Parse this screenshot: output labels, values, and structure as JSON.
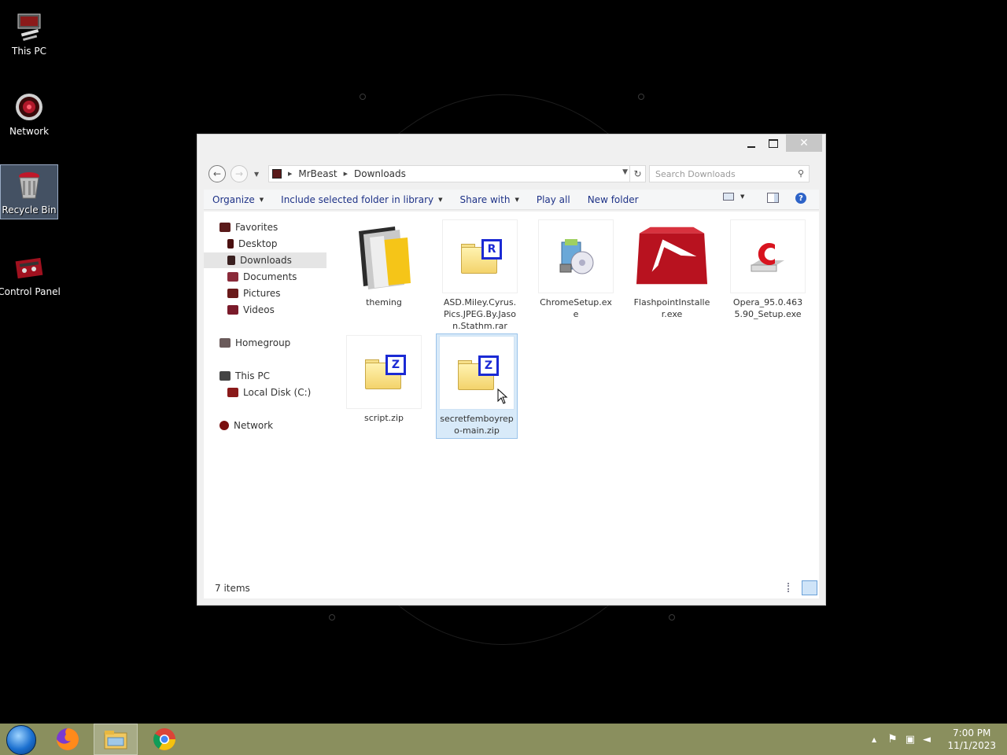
{
  "desktop": {
    "icons": [
      {
        "label": "This PC",
        "icon": "computer-icon"
      },
      {
        "label": "Network",
        "icon": "network-icon"
      },
      {
        "label": "Recycle Bin",
        "icon": "recycle-bin-icon"
      },
      {
        "label": "Control Panel",
        "icon": "control-panel-icon"
      }
    ]
  },
  "window": {
    "controls": {
      "close": "✕"
    },
    "breadcrumb": [
      "MrBeast",
      "Downloads"
    ],
    "search": {
      "placeholder": "Search Downloads"
    },
    "toolbar": {
      "organize": "Organize",
      "include": "Include selected folder in library",
      "share": "Share with",
      "play": "Play all",
      "new_folder": "New folder"
    },
    "nav": {
      "favorites": "Favorites",
      "desktop": "Desktop",
      "downloads": "Downloads",
      "documents": "Documents",
      "pictures": "Pictures",
      "videos": "Videos",
      "homegroup": "Homegroup",
      "this_pc": "This PC",
      "local_disk": "Local Disk (C:)",
      "network": "Network"
    },
    "files": [
      {
        "name": "theming",
        "type": "folder"
      },
      {
        "name": "ASD.Miley.Cyrus.Pics.JPEG.By.Jason.Stathm.rar",
        "type": "rar"
      },
      {
        "name": "ChromeSetup.exe",
        "type": "setup"
      },
      {
        "name": "FlashpointInstaller.exe",
        "type": "flashpoint"
      },
      {
        "name": "Opera_95.0.4635.90_Setup.exe",
        "type": "opera"
      },
      {
        "name": "script.zip",
        "type": "zip"
      },
      {
        "name": "secretfemboyrepo-main.zip",
        "type": "zip",
        "selected": true
      }
    ],
    "status": "7 items"
  },
  "taskbar": {
    "apps": [
      "firefox-icon",
      "file-explorer-icon",
      "chrome-icon"
    ],
    "clock": {
      "time": "7:00 PM",
      "date": "11/1/2023"
    }
  }
}
